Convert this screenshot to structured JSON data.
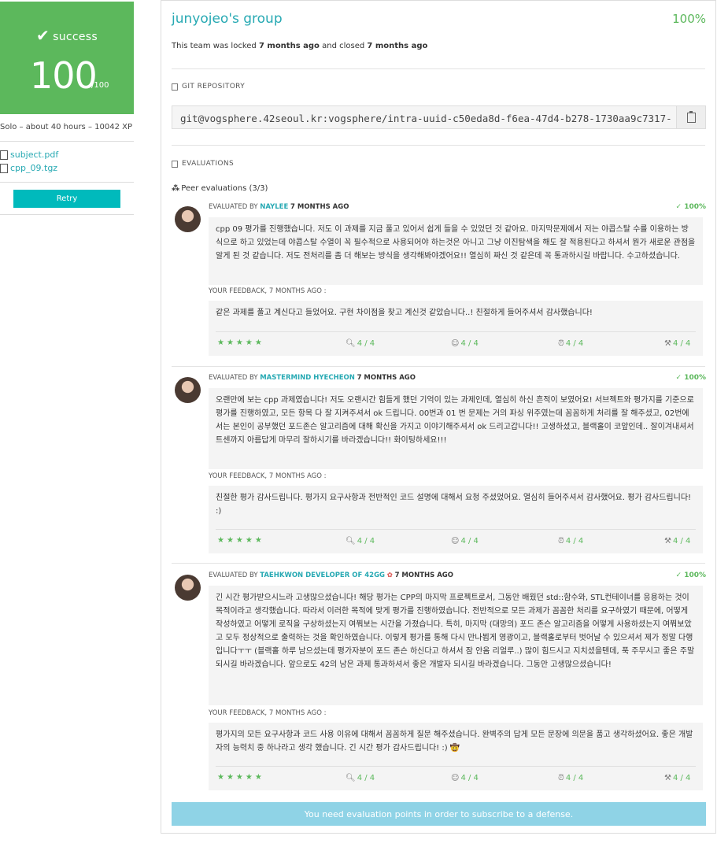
{
  "sidebar": {
    "status": "success",
    "score": "100",
    "score_max": "/100",
    "meta": "Solo – about 40 hours – 10042 XP",
    "files": [
      "subject.pdf",
      "cpp_09.tgz"
    ],
    "retry_label": "Retry"
  },
  "header": {
    "title": "junyojeo's group",
    "percent": "100%",
    "lock_prefix": "This team was locked",
    "lock_time": "7 months ago",
    "close_mid": "and closed",
    "close_time": "7 months ago"
  },
  "git": {
    "heading": "GIT REPOSITORY",
    "url": "git@vogsphere.42seoul.kr:vogsphere/intra-uuid-c50eda8d-f6ea-47d4-b278-1730aa9c7317-"
  },
  "evaluations": {
    "heading": "EVALUATIONS",
    "peer_heading": "Peer evaluations (3/3)",
    "items": [
      {
        "evaluated_by": "EVALUATED BY",
        "login": "NAYLEE",
        "ago": "7 MONTHS AGO",
        "score": "100%",
        "comment": "cpp 09 평가를 진행했습니다. 저도 이 과제를 지금 풀고 있어서 쉽게 들을 수 있었던 것 같아요. 마지막문제에서 저는 야콥스탈 수를 이용하는 방식으로 하고 있었는데 야콥스탈 수열이 꼭 필수적으로 사용되어야 하는것은 아니고 그냥 이진탐색을 해도 잘 적용된다고 하셔서 뭔가 새로운 관점을 알게 된 것 같습니다. 저도 전처리를 좀 더 해보는 방식을 생각해봐야겠어요!! 열심히 짜신 것 같은데 꼭 통과하시길 바랍니다. 수고하셨습니다.",
        "feedback_label": "YOUR FEEDBACK, 7 MONTHS AGO :",
        "feedback": "같은 과제를 풀고 계신다고 들었어요. 구현 차이점을 찾고 계신것 같았습니다..! 친절하게 들어주셔서 감사했습니다!",
        "stars": "★★★★★",
        "ratings": [
          "4 / 4",
          "4 / 4",
          "4 / 4",
          "4 / 4"
        ]
      },
      {
        "evaluated_by": "EVALUATED BY",
        "login": "MASTERMIND HYECHEON",
        "ago": "7 MONTHS AGO",
        "score": "100%",
        "comment": "오랜만에 보는 cpp 과제였습니다! 저도 오랜시간 힘들게 했던 기억이 있는 과제인데, 열심히 하신 흔적이 보였어요! 서브젝트와 평가지를 기준으로 평가를 진행하였고, 모든 항목 다 잘 지켜주셔서 ok 드립니다. 00번과 01 번 문제는 거의 파싱 위주였는데 꼼꼼하게 처리를 잘 해주셨고, 02번에서는 본인이 공부했던 포드존슨 알고리즘에 대해 확신을 가지고 이야기해주셔서 ok 드리고갑니다!! 고생하셨고, 블랙홀이 코앞인데.. 잘이겨내셔서 트센까지 아름답게 마무리 잘하시기를 바라겠습니다!! 화이팅하세요!!!",
        "feedback_label": "YOUR FEEDBACK, 7 MONTHS AGO :",
        "feedback": "친절한 평가 감사드립니다. 평가지 요구사항과 전반적인 코드 설명에 대해서 요청 주셨었어요. 열심히 들어주셔서 감사했어요. 평가 감사드립니다! :)",
        "stars": "★★★★★",
        "ratings": [
          "4 / 4",
          "4 / 4",
          "4 / 4",
          "4 / 4"
        ]
      },
      {
        "evaluated_by": "EVALUATED BY",
        "login": "TAEHKWON DEVELOPER OF 42GG",
        "ago": "7 MONTHS AGO",
        "score": "100%",
        "comment": "긴 시간 평가받으시느라 고생많으셨습니다! 해당 평가는 CPP의 마지막 프로젝트로서, 그동안 배웠던 std::함수와, STL컨테이너를 응용하는 것이 목적이라고 생각했습니다. 따라서 이러한 목적에 맞게 평가를 진행하였습니다. 전반적으로 모든 과제가 꼼꼼한 처리를 요구하였기 때문에, 어떻게 작성하였고 어떻게 로직을 구상하셨는지 여쭤보는 시간을 가졌습니다. 특히, 마지막 (대망의) 포드 존슨 알고리즘을 어떻게 사용하셨는지 여쭤보았고 모두 정상적으로 출력하는 것을 확인하였습니다. 이렇게 평가를 통해 다시 만나뵙게 영광이고, 블랙홀로부터 벗어날 수 있으셔서 제가 정말 다행입니다ㅜㅜ (블랙홀 하루 남으셨는데 평가자분이 포드 존슨 하신다고 하셔서 잠 안옴 리얼루..) 많이 힘드시고 지치셨을텐데, 푹 주무시고 좋은 주말 되시길 바라겠습니다. 앞으로도 42의 남은 과제 통과하셔서 좋은 개발자 되시길 바라겠습니다. 그동안 고생많으셨습니다!",
        "feedback_label": "YOUR FEEDBACK, 7 MONTHS AGO :",
        "feedback": "평가지의 모든 요구사항과 코드 사용 이유에 대해서 꼼꼼하게 질문 해주셨습니다. 완벽주의 답게 모든 문장에 의문을 품고 생각하셨어요. 좋은 개발자의 능력치 중 하나라고 생각 했습니다. 긴 시간 평가 감사드립니다! :) 🤠",
        "stars": "★★★★★",
        "ratings": [
          "4 / 4",
          "4 / 4",
          "4 / 4",
          "4 / 4"
        ]
      }
    ]
  },
  "defense_notice": "You need evaluation points in order to subscribe to a defense."
}
